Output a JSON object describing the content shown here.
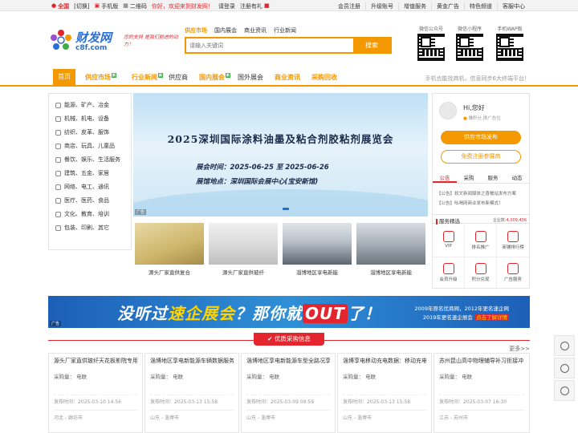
{
  "topbar": {
    "region": "全国",
    "switch": "[切换]",
    "mobile": "手机版",
    "qrcode": "二维码",
    "welcome": "你好，欢迎来到财发网！",
    "login": "请登录",
    "register": "注册有礼",
    "links": [
      "会员注册",
      "升级账号",
      "增值服务",
      "黄金广告",
      "特色频道",
      "客服中心"
    ]
  },
  "header": {
    "logo_title": "财发网",
    "logo_url": "c8f.com",
    "slogan": "您的支持 是我们前进的动力！",
    "search_tabs": [
      "供应市场",
      "国内展会",
      "商业资讯",
      "行业新闻"
    ],
    "search_placeholder": "请输入关键词",
    "search_button": "搜索",
    "qr_labels": [
      "微信公众号",
      "微信小程序",
      "手机WAP版"
    ]
  },
  "nav": {
    "home": "首页",
    "items": [
      "供应市场",
      "行业新闻",
      "供应商",
      "国内展会",
      "国外展会",
      "商业资讯",
      "采购回收"
    ],
    "new_badge": "新",
    "tip": "手机也能找商机，信息同步6大终端平台！"
  },
  "categories": [
    "能源、矿产、冶金",
    "机械、机电、设备",
    "纺织、皮革、服饰",
    "商店、玩具、儿童品",
    "餐饮、娱乐、生活服务",
    "建筑、五金、家居",
    "网络、电工、通讯",
    "医疗、医药、食品",
    "文化、教育、培训",
    "包装、印刷、其它"
  ],
  "banner": {
    "title": "2025深圳国际涂料油墨及粘合剂胶粘剂展览会",
    "time": "展会时间：2025-06-25 至 2025-06-26",
    "place": "展馆地点：深圳国际会展中心(宝安新馆)",
    "tag": "广告"
  },
  "thumbs": [
    "源头厂家直供复合",
    "源头厂家直供玻纤",
    "淄博地区享电新能",
    "淄博地区享电新能"
  ],
  "user": {
    "greeting": "Hi,您好",
    "hint": "赚积分,换广告位",
    "publish_button": "供应市场发布",
    "register_button": "免费注册参展商"
  },
  "notice_tabs": [
    "公告",
    "采购",
    "服务",
    "动态"
  ],
  "notices": [
    "【公告】软文新闻媒体之喜餐站发布方案",
    "【公告】吆喝网商业发布新模式！"
  ],
  "services": {
    "title": "服务精选",
    "count_label": "企业数:",
    "count": "4,009,436",
    "items": [
      "VIP",
      "排名推广",
      "商铺排行榜",
      "会员升级",
      "积分兑现",
      "广告服务"
    ]
  },
  "ad": {
    "part1": "没听过",
    "part2": "速企展会",
    "part3": "？那你就",
    "part4": "OUT",
    "part5": "了！",
    "sub1": "2009年原名优商网，2012年更名速企网",
    "sub2": "2019年更名速企展会",
    "sub3": "点击了解详情",
    "tag": "广告"
  },
  "purchase": {
    "title": "优质采购信息",
    "more": "更多>>",
    "cards": [
      {
        "name": "源头厂家直供玻纤天花板影院专用",
        "qty": "采购量：  电联",
        "date": "发布时间：2025-03-10 14:56",
        "loc": "河北 - 廊坊市"
      },
      {
        "name": "淄博地区享电新能源车辆数据服务",
        "qty": "采购量：  电联",
        "date": "发布时间：2025-03-13 15:58",
        "loc": "山东 - 淄博市"
      },
      {
        "name": "淄博地区享电新能源车型全路况享",
        "qty": "采购量：  电联",
        "date": "发布时间：2025-03-09 09:59",
        "loc": "山东 - 淄博市"
      },
      {
        "name": "淄博享电移动充电数据：移动充电",
        "qty": "采购量：  电联",
        "date": "发布时间：2025-03-13 15:58",
        "loc": "山东 - 淄博市"
      },
      {
        "name": "苏州昆山高中物理辅导补习拒接冲",
        "qty": "采购量：  电联",
        "date": "发布时间：2025-03-07 16:30",
        "loc": "江苏 - 苏州市"
      }
    ]
  },
  "colors": {
    "accent": "#f39800",
    "red": "#e3262e",
    "blue": "#2a6fd6"
  }
}
